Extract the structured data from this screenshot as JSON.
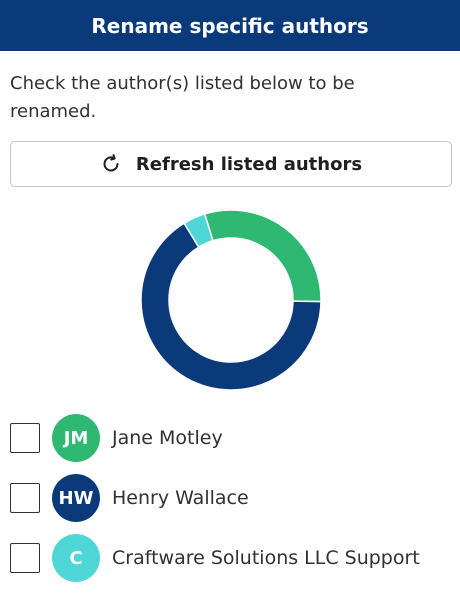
{
  "header": {
    "title": "Rename specific authors"
  },
  "instructions": "Check the author(s) listed below to be renamed.",
  "refresh_button": {
    "label": "Refresh listed authors",
    "icon": "refresh-icon"
  },
  "colors": {
    "header_bg": "#0b3a7a",
    "green": "#2eb872",
    "navy": "#0b3a7a",
    "teal": "#4fd6d6"
  },
  "chart_data": {
    "type": "pie",
    "style": "donut",
    "series": [
      {
        "values": [
          30,
          66,
          4
        ]
      }
    ],
    "colors": [
      "#2eb872",
      "#0b3a7a",
      "#4fd6d6"
    ]
  },
  "authors": [
    {
      "initials": "JM",
      "name": "Jane Motley",
      "color": "#2eb872",
      "checked": false
    },
    {
      "initials": "HW",
      "name": "Henry Wallace",
      "color": "#0b3a7a",
      "checked": false
    },
    {
      "initials": "C",
      "name": "Craftware Solutions LLC Support",
      "color": "#4fd6d6",
      "checked": false
    }
  ]
}
